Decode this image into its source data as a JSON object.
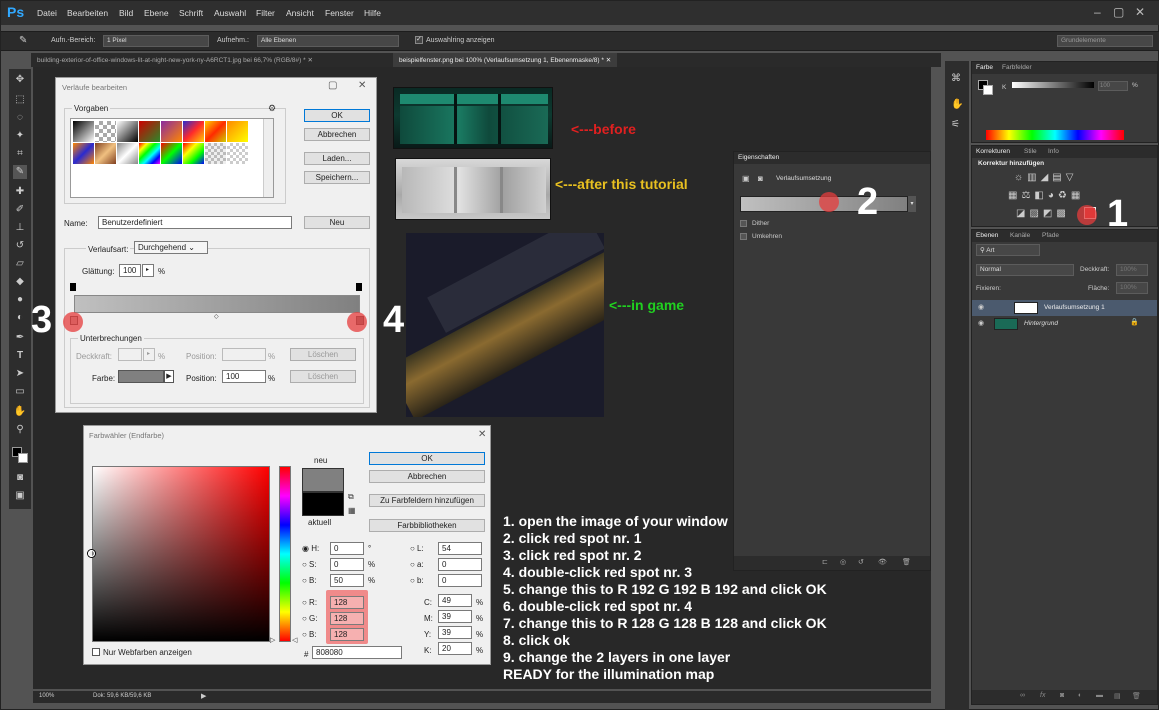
{
  "app": {
    "logo": "Ps",
    "menu": [
      "Datei",
      "Bearbeiten",
      "Bild",
      "Ebene",
      "Schrift",
      "Auswahl",
      "Filter",
      "Ansicht",
      "Fenster",
      "Hilfe"
    ],
    "win_min": "–",
    "win_max": "▢",
    "win_close": "✕"
  },
  "options": {
    "sample_label": "Aufn.-Bereich:",
    "sample_value": "1 Pixel",
    "layers_label": "Aufnehm.:",
    "layers_value": "Alle Ebenen",
    "ring_label": "Auswahlring anzeigen",
    "workspace": "Grundelemente"
  },
  "doc_tabs": [
    "building-exterior-of-office-windows-lit-at-night-new-york-ny-A6RCT1.jpg bei 66,7% (RGB/8#) *",
    "beispielfenster.png bei 100% (Verlaufsumsetzung 1, Ebenenmaske/8) *"
  ],
  "status": {
    "zoom": "100%",
    "doc": "Dok: 59,6 KB/59,6 KB"
  },
  "gradient_dialog": {
    "title": "Verläufe bearbeiten",
    "presets_label": "Vorgaben",
    "ok": "OK",
    "cancel": "Abbrechen",
    "load": "Laden...",
    "save": "Speichern...",
    "name_label": "Name:",
    "name_value": "Benutzerdefiniert",
    "new": "Neu",
    "type_label": "Verlaufsart:",
    "type_value": "Durchgehend",
    "smooth_label": "Glättung:",
    "smooth_value": "100",
    "pct": "%",
    "stops_label": "Unterbrechungen",
    "opacity_label": "Deckkraft:",
    "position_label": "Position:",
    "delete": "Löschen",
    "color_label": "Farbe:",
    "position_value": "100"
  },
  "color_dialog": {
    "title": "Farbwähler (Endfarbe)",
    "ok": "OK",
    "cancel": "Abbrechen",
    "add_swatches": "Zu Farbfeldern hinzufügen",
    "libraries": "Farbbibliotheken",
    "new_label": "neu",
    "current_label": "aktuell",
    "web_only": "Nur Webfarben anzeigen",
    "H": "0",
    "S": "0",
    "Bv": "50",
    "R": "128",
    "G": "128",
    "B": "128",
    "L": "54",
    "a": "0",
    "b": "0",
    "C": "49",
    "M": "39",
    "Y": "39",
    "K": "20",
    "hex": "808080",
    "deg": "°"
  },
  "properties": {
    "tab": "Eigenschaften",
    "title": "Verlaufsumsetzung",
    "dither": "Dither",
    "reverse": "Umkehren"
  },
  "color_panel": {
    "tabs": [
      "Farbe",
      "Farbfelder"
    ],
    "k_label": "K",
    "k_value": "100",
    "pct": "%"
  },
  "adjust_panel": {
    "tabs": [
      "Korrekturen",
      "Stile",
      "Info"
    ],
    "title": "Korrektur hinzufügen"
  },
  "layers_panel": {
    "tabs": [
      "Ebenen",
      "Kanäle",
      "Pfade"
    ],
    "filter": "Art",
    "blend": "Normal",
    "opacity_label": "Deckkraft:",
    "opacity": "100%",
    "lock_label": "Fixieren:",
    "fill_label": "Fläche:",
    "fill": "100%",
    "layers": [
      "Verlaufsumsetzung 1",
      "Hintergrund"
    ]
  },
  "annotations": {
    "before": "<---before",
    "after": "<---after this tutorial",
    "ingame": "<---in game",
    "n1": "1",
    "n2": "2",
    "n3": "3",
    "n4": "4",
    "colors": {
      "before": "#e02020",
      "after": "#e8c020",
      "ingame": "#20d020"
    }
  },
  "instructions": [
    "1. open the image of your window",
    "2. click red spot nr. 1",
    "3. click red spot nr. 2",
    "4. double-click red spot nr. 3",
    "5. change this to R 192 G 192 B 192 and click OK",
    "6. double-click red spot nr. 4",
    "7. change this to R 128 G 128 B 128 and click OK",
    "8. click ok",
    "9. change the 2 layers in one layer",
    "READY for the illumination map"
  ]
}
